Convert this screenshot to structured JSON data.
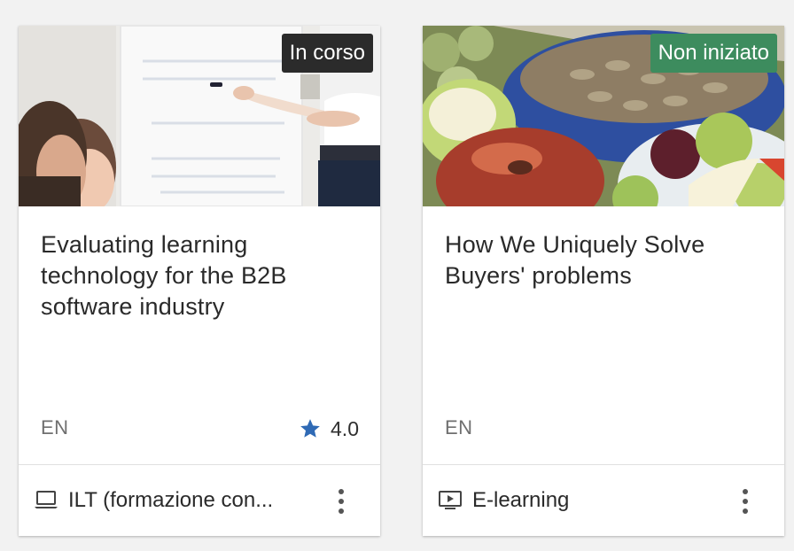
{
  "colors": {
    "badge_in_progress": "#2b2b2b",
    "badge_not_started": "#3d8c5e",
    "star": "#2f6ab5"
  },
  "cards": [
    {
      "badge": "In corso",
      "title": "Evaluating learning technology for the B2B software industry",
      "language": "EN",
      "rating": "4.0",
      "type_icon": "laptop-icon",
      "type_label": "ILT (formazione con..."
    },
    {
      "badge": "Non iniziato",
      "title": "How We Uniquely Solve Buyers' problems",
      "language": "EN",
      "type_icon": "video-play-icon",
      "type_label": "E-learning"
    }
  ]
}
